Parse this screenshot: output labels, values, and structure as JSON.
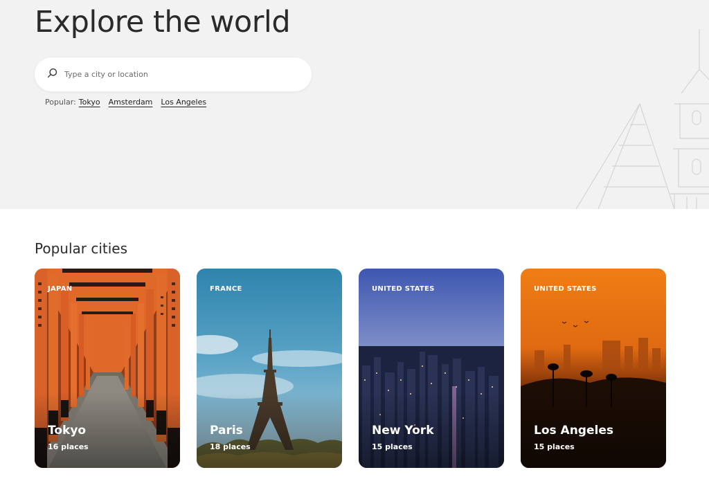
{
  "hero": {
    "title": "Explore the world",
    "search_placeholder": "Type a city or location",
    "popular_label": "Popular:",
    "popular_tags": [
      "Tokyo",
      "Amsterdam",
      "Los Angeles"
    ]
  },
  "section_title": "Popular cities",
  "cities": [
    {
      "country": "JAPAN",
      "name": "Tokyo",
      "places": "16 places"
    },
    {
      "country": "FRANCE",
      "name": "Paris",
      "places": "18 places"
    },
    {
      "country": "UNITED STATES",
      "name": "New York",
      "places": "15 places"
    },
    {
      "country": "UNITED STATES",
      "name": "Los Angeles",
      "places": "15 places"
    }
  ],
  "colors": {
    "hero_bg": "#f2f2f2",
    "text_dark": "#2a2a2a",
    "torii_orange": "#d8642a",
    "paris_sky": "#3d8fb6",
    "ny_dusk": "#4a5aa0",
    "la_sunset": "#f08a1c"
  }
}
